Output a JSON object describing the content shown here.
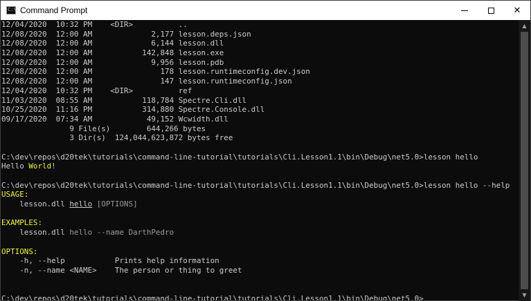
{
  "window": {
    "title": "Command Prompt",
    "icon_text": "C:\\.",
    "controls": {
      "minimize": "minimize",
      "maximize": "maximize",
      "close": "✕"
    }
  },
  "console": {
    "listing": [
      "12/04/2020  10:32 PM    <DIR>          ..",
      "12/08/2020  12:00 AM             2,177 lesson.deps.json",
      "12/08/2020  12:00 AM             6,144 lesson.dll",
      "12/08/2020  12:00 AM           142,848 lesson.exe",
      "12/08/2020  12:00 AM             9,956 lesson.pdb",
      "12/08/2020  12:00 AM               178 lesson.runtimeconfig.dev.json",
      "12/08/2020  12:00 AM               147 lesson.runtimeconfig.json",
      "12/04/2020  10:32 PM    <DIR>          ref",
      "11/03/2020  08:55 AM           118,784 Spectre.Cli.dll",
      "10/25/2020  11:16 PM           314,880 Spectre.Console.dll",
      "09/17/2020  07:34 AM            49,152 Wcwidth.dll",
      "               9 File(s)        644,266 bytes",
      "               3 Dir(s)  124,044,623,872 bytes free"
    ],
    "prompt1": "C:\\dev\\repos\\d20tek\\tutorials\\command-line-tutorial\\tutorials\\Cli.Lesson1.1\\bin\\Debug\\net5.0>lesson hello",
    "hello_word": "Hello",
    "world_word": "World",
    "exclaim": "!",
    "prompt2": "C:\\dev\\repos\\d20tek\\tutorials\\command-line-tutorial\\tutorials\\Cli.Lesson1.1\\bin\\Debug\\net5.0>lesson hello --help",
    "usage_header": "USAGE:",
    "usage_dll": "    lesson.dll ",
    "usage_cmd": "hello",
    "usage_opts": " [OPTIONS]",
    "examples_header": "EXAMPLES:",
    "example_dll": "    lesson.dll ",
    "example_cmd": "hello --name DarthPedro",
    "options_header": "OPTIONS:",
    "option_help": "    -h, --help           Prints help information",
    "option_name": "    -n, --name <NAME>    The person or thing to greet",
    "prompt3": "C:\\dev\\repos\\d20tek\\tutorials\\command-line-tutorial\\tutorials\\Cli.Lesson1.1\\bin\\Debug\\net5.0>"
  },
  "colors": {
    "background": "#0c0c0c",
    "text": "#cccccc",
    "highlight_yellow": "#f1f148",
    "dim_gray": "#9a9a9a"
  },
  "scrollbar": {
    "up": "▲",
    "down": "▼"
  }
}
